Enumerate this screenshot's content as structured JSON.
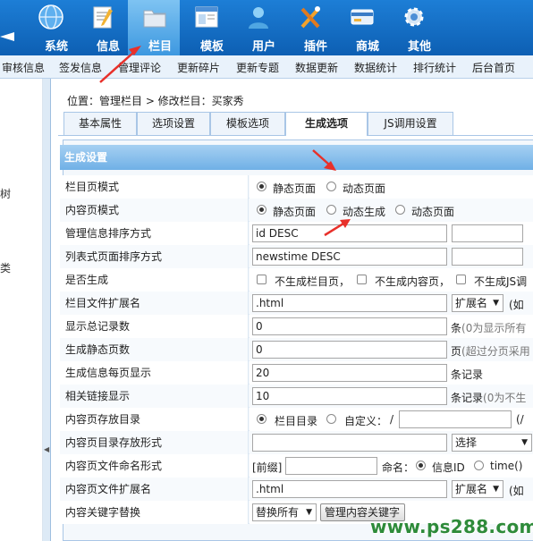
{
  "top_nav": [
    {
      "label": "系统",
      "icon": "globe-icon"
    },
    {
      "label": "信息",
      "icon": "notepad-icon"
    },
    {
      "label": "栏目",
      "icon": "folder-icon",
      "active": true
    },
    {
      "label": "模板",
      "icon": "window-icon"
    },
    {
      "label": "用户",
      "icon": "user-icon"
    },
    {
      "label": "插件",
      "icon": "tools-icon"
    },
    {
      "label": "商城",
      "icon": "card-icon"
    },
    {
      "label": "其他",
      "icon": "gear-icon"
    }
  ],
  "sub_nav": [
    "审核信息",
    "签发信息",
    "管理评论",
    "更新碎片",
    "更新专题",
    "数据更新",
    "数据统计",
    "排行统计",
    "后台首页"
  ],
  "left_fragments": [
    "树",
    "类"
  ],
  "breadcrumb": "位置：管理栏目 > 修改栏目：买家秀",
  "tabs": [
    "基本属性",
    "选项设置",
    "模板选项",
    "生成选项",
    "JS调用设置"
  ],
  "active_tab": "生成选项",
  "section_title": "生成设置",
  "rows": {
    "list_mode": {
      "label": "栏目页模式",
      "options": [
        "静态页面",
        "动态页面"
      ]
    },
    "content_mode": {
      "label": "内容页模式",
      "options": [
        "静态页面",
        "动态生成",
        "动态页面"
      ]
    },
    "info_sort": {
      "label": "管理信息排序方式",
      "value": "id DESC"
    },
    "list_sort": {
      "label": "列表式页面排序方式",
      "value": "newstime DESC"
    },
    "generate": {
      "label": "是否生成",
      "options": [
        "不生成栏目页，",
        "不生成内容页，",
        "不生成JS调"
      ]
    },
    "list_ext": {
      "label": "栏目文件扩展名",
      "value": ".html",
      "select": "扩展名",
      "hint": "(如"
    },
    "total_records": {
      "label": "显示总记录数",
      "value": "0",
      "hint_strong": "条",
      "hint": "(0为显示所有"
    },
    "static_pages": {
      "label": "生成静态页数",
      "value": "0",
      "hint_strong": "页",
      "hint": "(超过分页采用"
    },
    "per_page": {
      "label": "生成信息每页显示",
      "value": "20",
      "hint_strong": "条记录"
    },
    "related_links": {
      "label": "相关链接显示",
      "value": "10",
      "hint_strong": "条记录",
      "hint": "(0为不生"
    },
    "content_dir": {
      "label": "内容页存放目录",
      "options": [
        "栏目目录",
        "自定义："
      ],
      "slash": "/",
      "hint": "(/"
    },
    "content_dir_form": {
      "label": "内容页目录存放形式",
      "select": "选择"
    },
    "content_naming": {
      "label": "内容页文件命名形式",
      "prefix": "[前缀]",
      "name_label": "命名：",
      "options": [
        "信息ID",
        "time()"
      ]
    },
    "content_ext": {
      "label": "内容页文件扩展名",
      "value": ".html",
      "select": "扩展名",
      "hint": "(如"
    },
    "keyword_replace": {
      "label": "内容关键字替换",
      "select": "替换所有",
      "button": "管理内容关键字"
    }
  },
  "watermark": "www.ps288.com",
  "colors": {
    "nav_bg": "#1468c0",
    "annotation_red": "#e8302a",
    "watermark_green": "#2e8b3a"
  }
}
